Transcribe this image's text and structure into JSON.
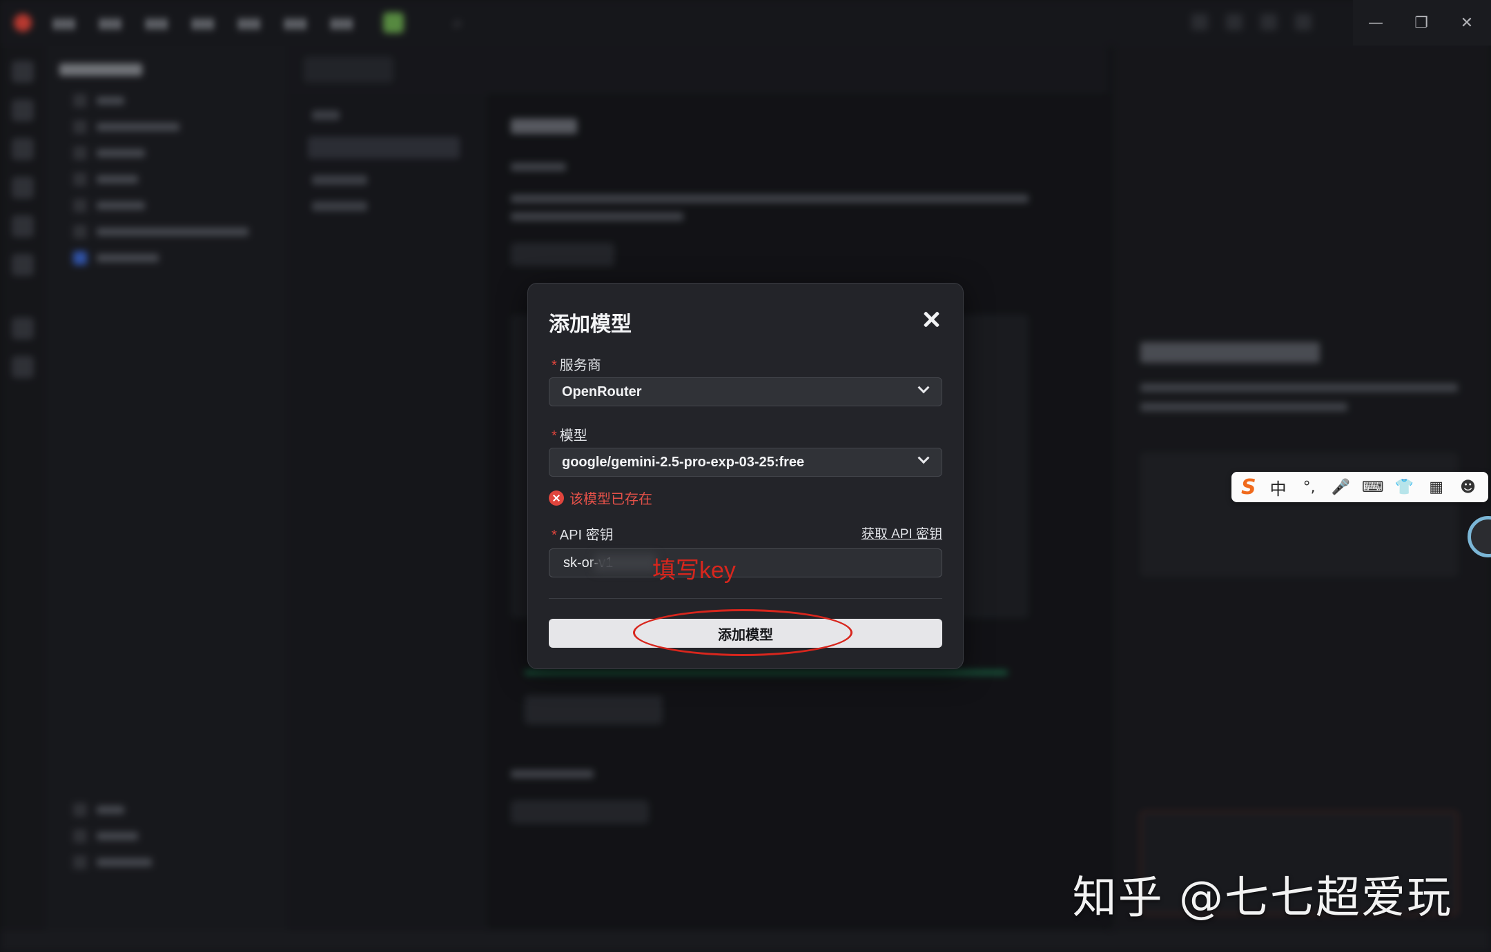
{
  "window": {
    "controls": [
      "minimize",
      "restore",
      "close"
    ]
  },
  "modal": {
    "title": "添加模型",
    "provider_label": "服务商",
    "provider_value": "OpenRouter",
    "model_label": "模型",
    "model_value": "google/gemini-2.5-pro-exp-03-25:free",
    "error_text": "该模型已存在",
    "api_key_label": "API 密钥",
    "get_key_link": "获取 API 密钥",
    "api_key_value": "sk-or-v1",
    "submit_label": "添加模型",
    "required_mark": "*"
  },
  "annotation": {
    "text": "填写key",
    "color": "#d8261d"
  },
  "ime_toolbar": {
    "brand_glyph": "S",
    "language": "中",
    "icons": [
      "punctuation-icon",
      "microphone-icon",
      "keyboard-icon",
      "skin-icon",
      "grid-icon",
      "avatar-icon"
    ]
  },
  "watermark": "知乎 @七七超爱玩",
  "colors": {
    "error": "#e0453d",
    "accent_red": "#d8261d",
    "ime_brand": "#f06a1c"
  }
}
